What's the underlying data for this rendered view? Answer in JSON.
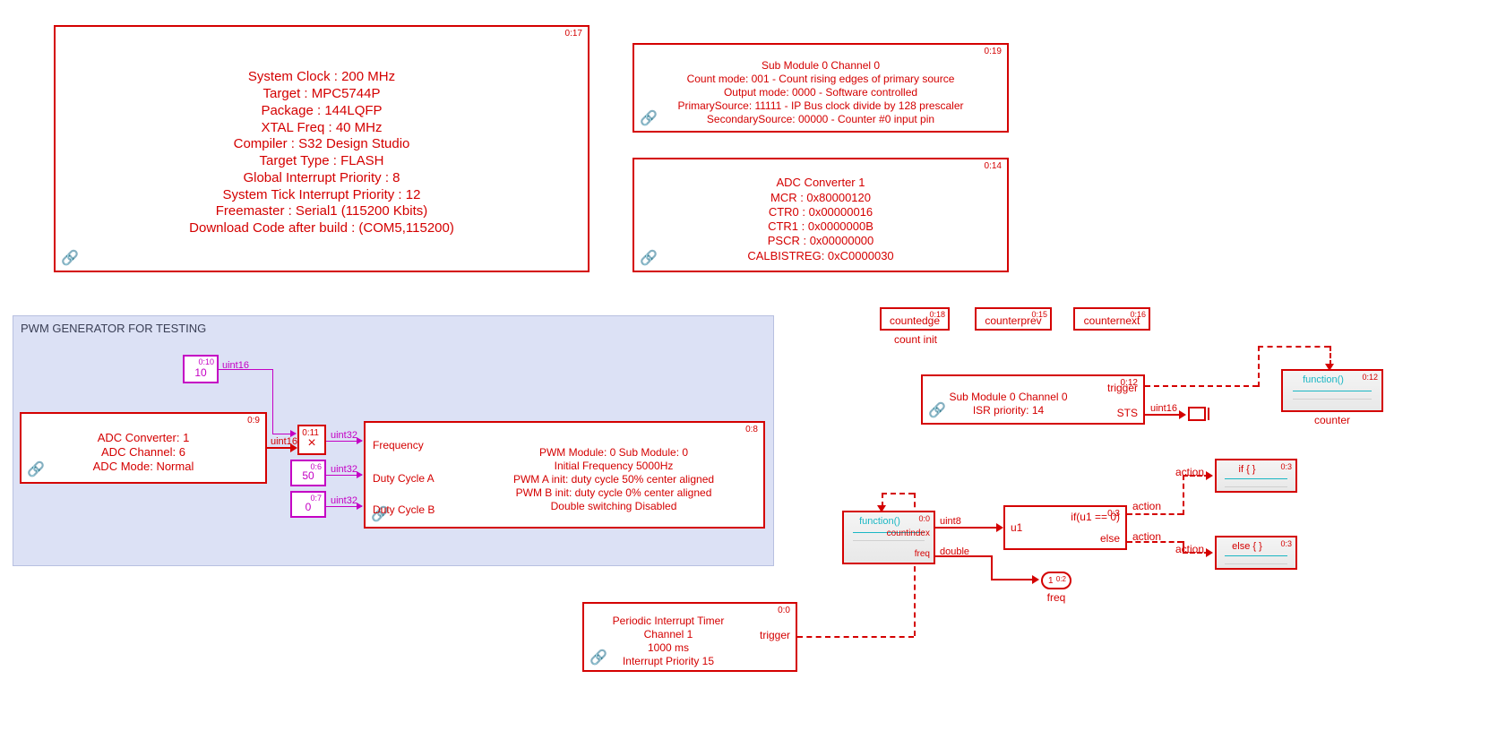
{
  "sysblock": {
    "tag": "0:17",
    "lines": [
      "System Clock : 200 MHz",
      "Target : MPC5744P",
      "Package : 144LQFP",
      "XTAL Freq : 40 MHz",
      "Compiler : S32 Design Studio",
      "Target Type : FLASH",
      "Global Interrupt Priority : 8",
      "System Tick Interrupt Priority : 12",
      "Freemaster : Serial1 (115200 Kbits)",
      "Download Code after build : (COM5,115200)"
    ]
  },
  "etimer_cfg": {
    "tag": "0:19",
    "lines": [
      "Sub Module 0 Channel 0",
      "Count mode: 001 - Count rising edges of primary source",
      "Output mode: 0000 - Software controlled",
      "PrimarySource: 11111 - IP Bus clock divide by 128 prescaler",
      "SecondarySource: 00000 - Counter #0 input pin"
    ]
  },
  "adc_cfg": {
    "tag": "0:14",
    "lines": [
      "ADC Converter 1",
      "MCR : 0x80000120",
      "CTR0 : 0x00000016",
      "CTR1 : 0x0000000B",
      "PSCR : 0x00000000",
      "CALBISTREG: 0xC0000030"
    ]
  },
  "group": {
    "title": "PWM GENERATOR FOR TESTING"
  },
  "adc_read": {
    "tag": "0:9",
    "lines": [
      "ADC Converter: 1",
      "ADC Channel: 6",
      "ADC Mode: Normal"
    ],
    "outtype": "uint16"
  },
  "const10": {
    "tag": "0:10",
    "value": "10",
    "type": "uint16"
  },
  "product": {
    "tag": "0:11",
    "symbol": "×",
    "outtype": "uint32"
  },
  "const50": {
    "tag": "0:6",
    "value": "50",
    "type": "uint32"
  },
  "const0": {
    "tag": "0:7",
    "value": "0",
    "type": "uint32"
  },
  "pwmblock": {
    "tag": "0:8",
    "ports": {
      "freq": "Frequency",
      "dcA": "Duty Cycle A",
      "dcB": "Duty Cycle B"
    },
    "lines": [
      "PWM Module: 0   Sub Module: 0",
      "Initial Frequency  5000Hz",
      "PWM A init: duty cycle 50% center aligned",
      "PWM B init: duty cycle 0% center aligned",
      "Double switching Disabled"
    ]
  },
  "tags_small": {
    "countedge": {
      "tag": "0:18",
      "label": "countedge",
      "below": "count init"
    },
    "counterprev": {
      "tag": "0:15",
      "label": "counterprev"
    },
    "counternext": {
      "tag": "0:16",
      "label": "counternext"
    }
  },
  "etimer_isr": {
    "tag": "0:12",
    "lines": [
      "Sub Module 0 Channel 0",
      "ISR priority: 14"
    ],
    "ports": {
      "trigger": "trigger",
      "sts": "STS"
    },
    "ststype": "uint16"
  },
  "counter_fn": {
    "tag": "0:12",
    "fn": "function()",
    "below": "counter"
  },
  "pit": {
    "tag": "0:0",
    "lines": [
      "Periodic Interrupt Timer",
      "Channel 1",
      "1000 ms",
      "Interrupt Priority 15"
    ],
    "ports": {
      "trigger": "trigger"
    }
  },
  "countindex_fn": {
    "tag": "0:0",
    "fn": "function()",
    "sublabels": {
      "ci": "countindex",
      "freq": "freq"
    },
    "citype": "uint8",
    "freqtype": "double"
  },
  "ifblock": {
    "tag": "0:3",
    "inport": "u1",
    "cond": "if(u1 == 0)",
    "else": "else",
    "out": "action"
  },
  "ifaction": {
    "tag": "0:3",
    "fn": "if { }",
    "port": "action"
  },
  "elseaction": {
    "tag": "0:3",
    "fn": "else { }",
    "port": "action"
  },
  "outport_freq": {
    "tag": "0:2",
    "num": "1",
    "below": "freq"
  }
}
